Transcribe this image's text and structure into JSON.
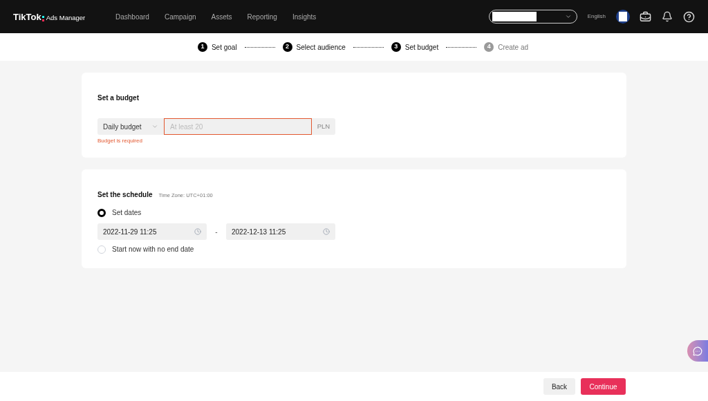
{
  "header": {
    "logo": "TikTok",
    "logo_sub": "Ads Manager",
    "nav": [
      {
        "label": "Dashboard"
      },
      {
        "label": "Campaign"
      },
      {
        "label": "Assets"
      },
      {
        "label": "Reporting"
      },
      {
        "label": "Insights"
      }
    ],
    "language": "English"
  },
  "steps": [
    {
      "number": "1",
      "label": "Set goal",
      "active": true
    },
    {
      "number": "2",
      "label": "Select audience",
      "active": true
    },
    {
      "number": "3",
      "label": "Set budget",
      "active": true
    },
    {
      "number": "4",
      "label": "Create ad",
      "active": false
    }
  ],
  "budget": {
    "title": "Set a budget",
    "type": "Daily budget",
    "placeholder": "At least 20",
    "currency": "PLN",
    "invalid": true,
    "error": "Budget is required"
  },
  "schedule": {
    "title": "Set the schedule",
    "timezone": "Time Zone: UTC+01:00",
    "options": [
      {
        "label": "Set dates",
        "selected": true
      },
      {
        "label": "Start now with no end date",
        "selected": false
      }
    ],
    "start": "2022-11-29 11:25",
    "separator": "-",
    "end": "2022-12-13 11:25"
  },
  "footer": {
    "buttons": [
      {
        "label": "Back",
        "kind": "secondary"
      },
      {
        "label": "Continue",
        "kind": "primary"
      }
    ]
  }
}
